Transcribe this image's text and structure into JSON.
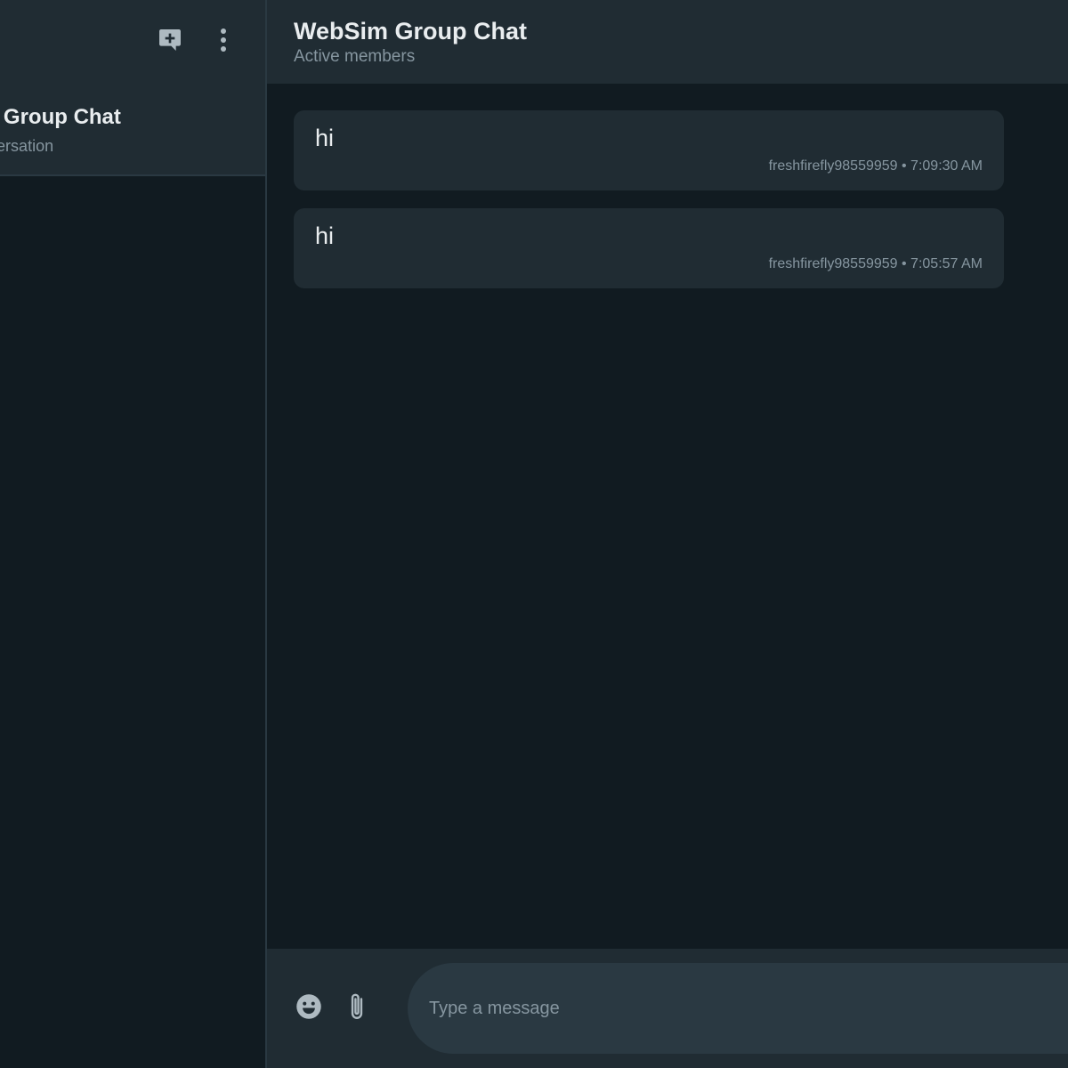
{
  "sidebar": {
    "header": {
      "new_chat_icon": "new-chat-icon",
      "menu_icon": "more-vert-icon"
    },
    "conversations": [
      {
        "title": "WebSim Group Chat",
        "subtitle": "Group conversation"
      }
    ]
  },
  "chat": {
    "title": "WebSim Group Chat",
    "subtitle": "Active members",
    "messages": [
      {
        "text": "hi",
        "author": "freshfirefly98559959",
        "separator": "•",
        "time": "7:09:30 AM",
        "meta": "freshfirefly98559959 • 7:09:30 AM"
      },
      {
        "text": "hi",
        "author": "freshfirefly98559959",
        "separator": "•",
        "time": "7:05:57 AM",
        "meta": "freshfirefly98559959 • 7:05:57 AM"
      }
    ]
  },
  "composer": {
    "placeholder": "Type a message",
    "value": "",
    "emoji_icon": "emoji-icon",
    "attach_icon": "attach-icon"
  },
  "colors": {
    "background": "#111b21",
    "panel": "#202c33",
    "input": "#2a3942",
    "text_primary": "#e9edef",
    "text_secondary": "#8696a0",
    "icon": "#aebac1"
  }
}
